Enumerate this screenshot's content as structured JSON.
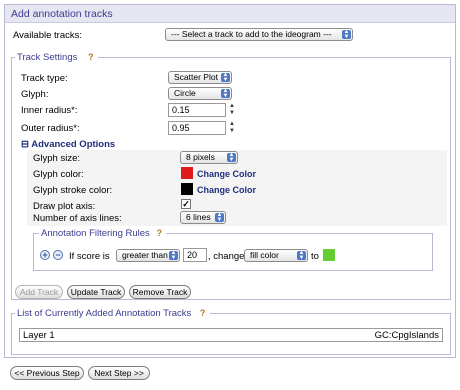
{
  "panel": {
    "title": "Add annotation tracks"
  },
  "available": {
    "label": "Available tracks:",
    "select_value": "--- Select a track to add to the ideogram ---"
  },
  "track_settings": {
    "legend": "Track Settings",
    "track_type_label": "Track type:",
    "track_type_value": "Scatter Plot",
    "glyph_label": "Glyph:",
    "glyph_value": "Circle",
    "inner_radius_label": "Inner radius*:",
    "inner_radius_value": "0.15",
    "outer_radius_label": "Outer radius*:",
    "outer_radius_value": "0.95"
  },
  "advanced": {
    "toggle_symbol": "⊟",
    "title": "Advanced Options",
    "glyph_size_label": "Glyph size:",
    "glyph_size_value": "8 pixels",
    "glyph_color_label": "Glyph color:",
    "glyph_color": "#e0191b",
    "glyph_color_link": "Change Color",
    "glyph_stroke_label": "Glyph stroke color:",
    "glyph_stroke_color": "#000000",
    "glyph_stroke_link": "Change Color",
    "draw_axis_label": "Draw plot axis:",
    "draw_axis_checked": true,
    "axis_lines_label": "Number of axis lines:",
    "axis_lines_value": "6 lines"
  },
  "filter": {
    "legend": "Annotation Filtering Rules",
    "if_text": "If score is",
    "operator_value": "greater than",
    "threshold_value": "20",
    "change_text": ", change",
    "attribute_value": "fill color",
    "to_text": "to",
    "target_color": "#66cc33"
  },
  "buttons": {
    "add_track": "Add Track",
    "update_track": "Update Track",
    "remove_track": "Remove Track"
  },
  "added_tracks": {
    "legend": "List of Currently Added Annotation Tracks",
    "rows": [
      {
        "name": "Layer 1",
        "source": "GC:CpgIslands"
      }
    ]
  },
  "nav": {
    "previous": "<< Previous Step",
    "next": "Next Step >>"
  }
}
